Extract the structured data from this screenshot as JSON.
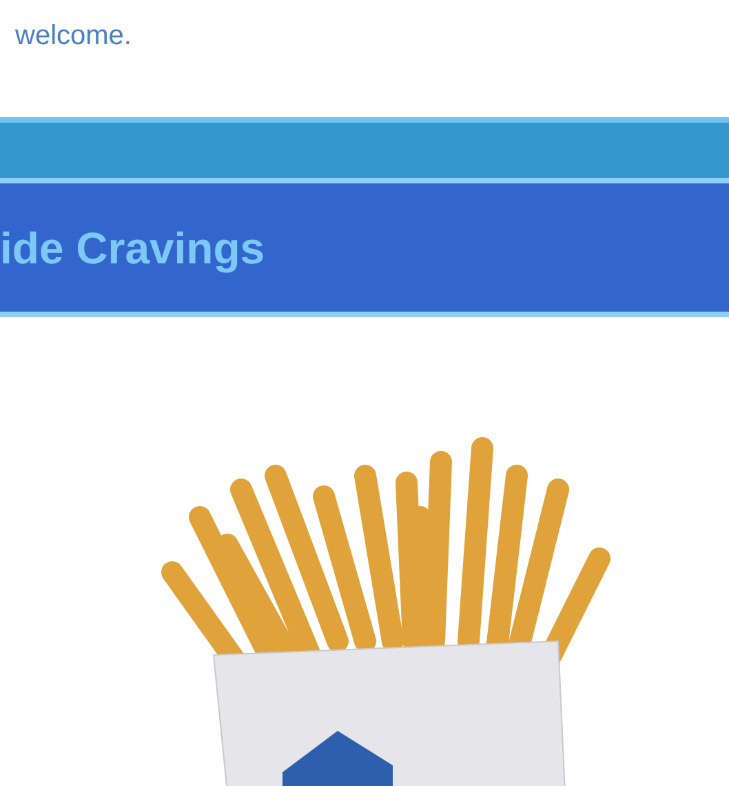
{
  "intro_text": "welcome.",
  "section_heading": "ide Cravings"
}
